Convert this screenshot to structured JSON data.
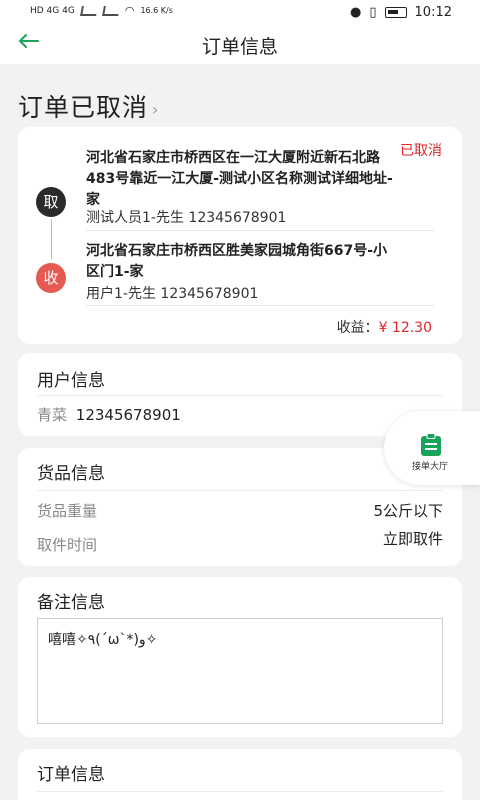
{
  "statusbar": {
    "net_left": "HD 4G 4G",
    "speed": "16.6 K/s",
    "time": "10:12"
  },
  "header": {
    "title": "订单信息"
  },
  "order_status": {
    "title": "订单已取消"
  },
  "address": {
    "state_badge": "已取消",
    "take_label": "取",
    "recv_label": "收",
    "pickup_address": "河北省石家庄市桥西区在一江大厦附近新石北路483号靠近一江大厦-测试小区名称测试详细地址-家",
    "pickup_contact": "测试人员1-先生  12345678901",
    "delivery_address": "河北省石家庄市桥西区胜美家园城角街667号-小区门1-家",
    "delivery_contact": "用户1-先生  12345678901",
    "income_label": "收益：",
    "income_amount": "¥ 12.30"
  },
  "user_info": {
    "title": "用户信息",
    "name": "青菜",
    "phone": "12345678901"
  },
  "goods_info": {
    "title": "货品信息",
    "weight_label": "货品重量",
    "weight_value": "5公斤以下",
    "pickup_time_label": "取件时间",
    "pickup_time_value": "立即取件"
  },
  "remark_info": {
    "title": "备注信息",
    "content": "嘻嘻✧٩(ˊωˋ*)و✧"
  },
  "order_info": {
    "title": "订单信息"
  },
  "float_button": {
    "label": "接单大厅"
  },
  "colors": {
    "accent": "#1aa35a",
    "cancel_red": "#e0262a",
    "recv_pin": "#e55a52"
  }
}
